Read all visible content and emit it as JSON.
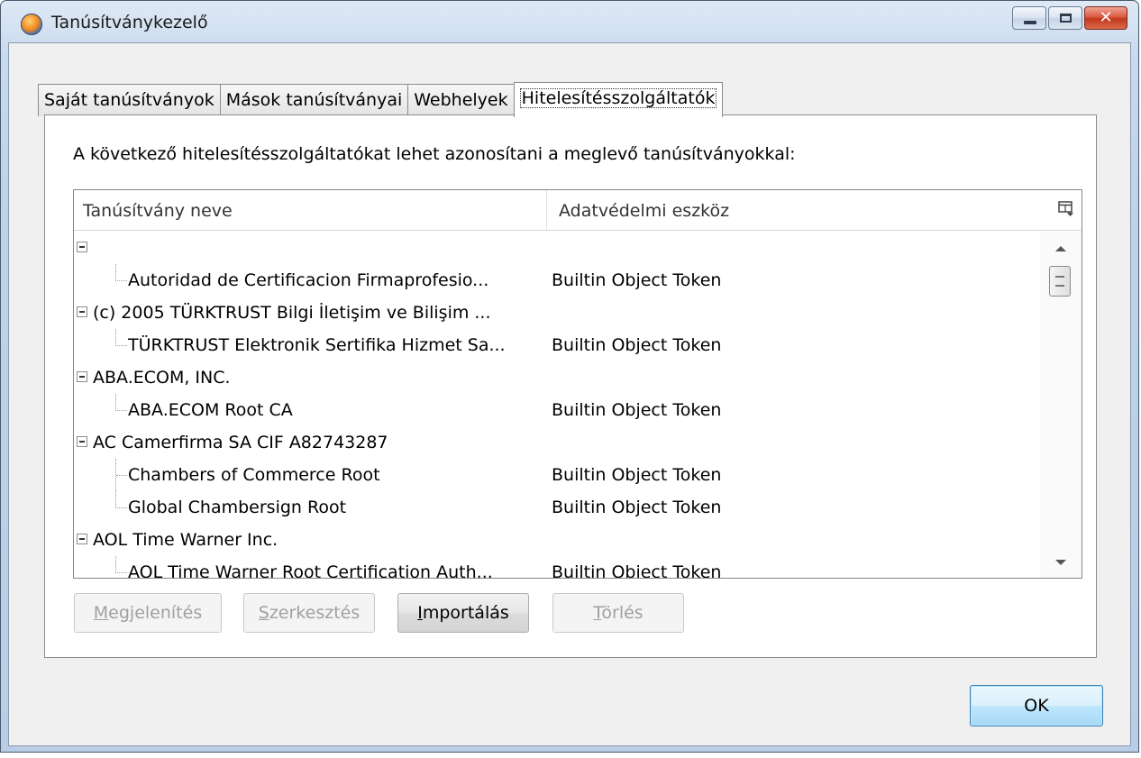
{
  "window": {
    "title": "Tanúsítványkezelő"
  },
  "tabs": [
    {
      "label": "Saját tanúsítványok"
    },
    {
      "label": "Mások tanúsítványai"
    },
    {
      "label": "Webhelyek"
    },
    {
      "label": "Hitelesítésszolgáltatók"
    }
  ],
  "panel": {
    "intro": "A következő hitelesítésszolgáltatókat lehet azonosítani a meglevő tanúsítványokkal:"
  },
  "tree": {
    "columns": {
      "name": "Tanúsítvány neve",
      "device": "Adatvédelmi eszköz"
    },
    "rows": [
      {
        "name": "",
        "device": ""
      },
      {
        "name": "Autoridad de Certificacion Firmaprofesio...",
        "device": "Builtin Object Token"
      },
      {
        "name": "(c) 2005 TÜRKTRUST Bilgi İletişim ve Bilişim ...",
        "device": ""
      },
      {
        "name": "TÜRKTRUST Elektronik Sertifika Hizmet Sa...",
        "device": "Builtin Object Token"
      },
      {
        "name": "ABA.ECOM, INC.",
        "device": ""
      },
      {
        "name": "ABA.ECOM Root CA",
        "device": "Builtin Object Token"
      },
      {
        "name": "AC Camerfirma SA CIF A82743287",
        "device": ""
      },
      {
        "name": "Chambers of Commerce Root",
        "device": "Builtin Object Token"
      },
      {
        "name": "Global Chambersign Root",
        "device": "Builtin Object Token"
      },
      {
        "name": "AOL Time Warner Inc.",
        "device": ""
      },
      {
        "name": "AOL Time Warner Root Certification Auth...",
        "device": "Builtin Object Token"
      }
    ]
  },
  "buttons": {
    "view": {
      "accel": "M",
      "rest": "egjelenítés"
    },
    "edit": {
      "accel": "S",
      "rest": "zerkesztés"
    },
    "import": {
      "accel": "I",
      "rest": "mportálás"
    },
    "delete": {
      "accel": "T",
      "rest": "örlés"
    },
    "ok": "OK"
  },
  "colors": {
    "title_gradient_top": "#dfe9f5",
    "close_red": "#c2361c",
    "ok_border": "#3c7fb1"
  }
}
